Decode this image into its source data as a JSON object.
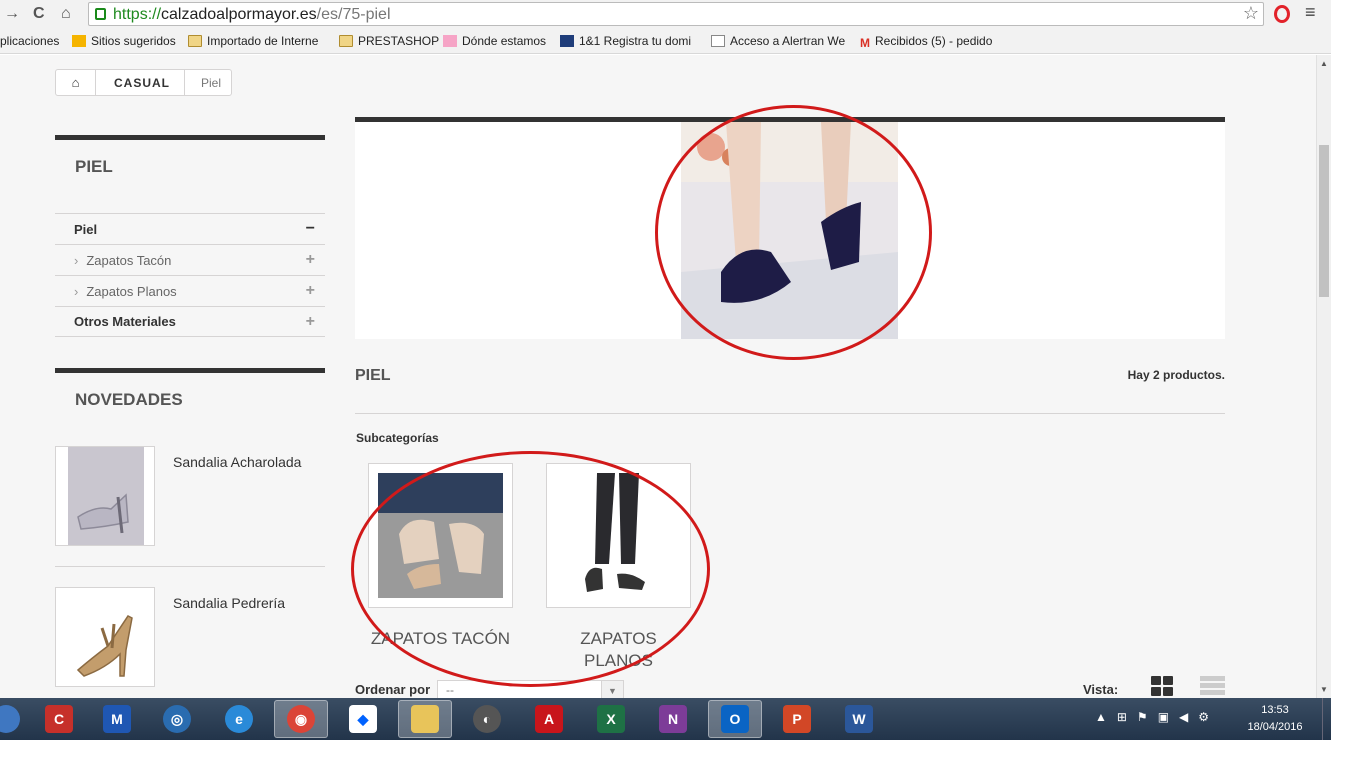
{
  "browser": {
    "url_scheme": "https://",
    "url_host": "calzadoalpormayor.es",
    "url_path": "/es/75-piel",
    "bookmarks": [
      "plicaciones",
      "Sitios sugeridos",
      "Importado de Interne",
      "PRESTASHOP",
      "Dónde estamos",
      "1&1 Registra tu domi",
      "Acceso a Alertran We",
      "Recibidos (5) - pedido"
    ]
  },
  "breadcrumb": {
    "category": "CASUAL",
    "current": "Piel"
  },
  "sidebar": {
    "category_block_title": "PIEL",
    "categories": [
      {
        "label": "Piel",
        "sign": "−"
      },
      {
        "label": "Zapatos Tacón",
        "sign": "+"
      },
      {
        "label": "Zapatos Planos",
        "sign": "+"
      },
      {
        "label": "Otros Materiales",
        "sign": "+"
      }
    ],
    "new_block_title": "NOVEDADES",
    "new_products": [
      "Sandalia Acharolada",
      "Sandalia Pedrería"
    ]
  },
  "main": {
    "category_name": "PIEL",
    "product_count": "Hay 2 productos.",
    "subcategories_title": "Subcategorías",
    "subcategories": [
      "Zapatos Tacón",
      "Zapatos Planos"
    ],
    "sort_label": "Ordenar por",
    "sort_value": "--",
    "view_label": "Vista:"
  },
  "taskbar": {
    "time": "13:53",
    "date": "18/04/2016"
  },
  "colors": {
    "annotation_red": "#d11a1a",
    "url_green": "#1e8a1e"
  }
}
